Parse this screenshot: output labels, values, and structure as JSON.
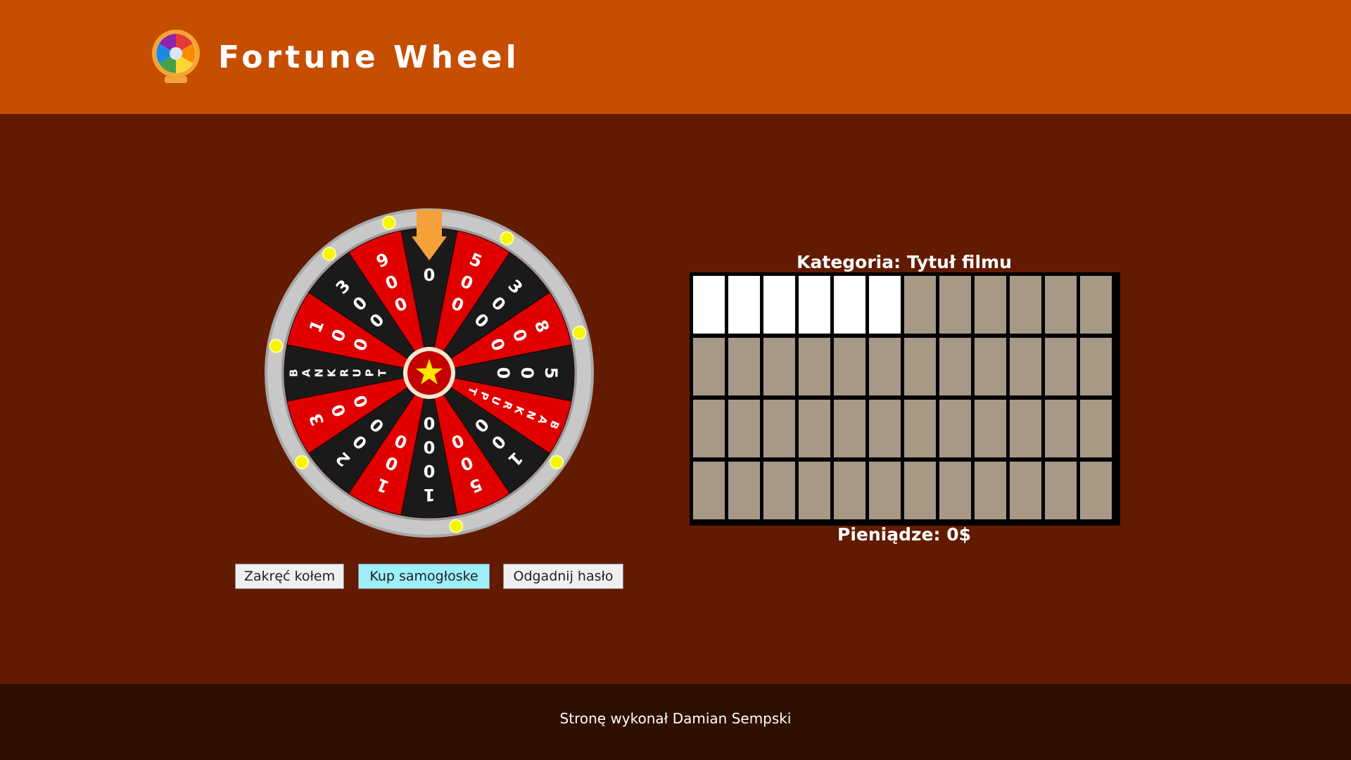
{
  "header": {
    "title": "Fortune Wheel",
    "logo_icon": "fortune-wheel-logo-icon"
  },
  "wheel": {
    "segments": [
      {
        "label": "00",
        "color": "#1a1a1a"
      },
      {
        "label": "500",
        "color": "#e00000"
      },
      {
        "label": "300",
        "color": "#1a1a1a"
      },
      {
        "label": "800",
        "color": "#e00000"
      },
      {
        "label": "500",
        "color": "#1a1a1a"
      },
      {
        "label": "BANKRUPT",
        "color": "#e00000"
      },
      {
        "label": "100",
        "color": "#1a1a1a"
      },
      {
        "label": "500",
        "color": "#e00000"
      },
      {
        "label": "1000",
        "color": "#1a1a1a"
      },
      {
        "label": "100",
        "color": "#e00000"
      },
      {
        "label": "200",
        "color": "#1a1a1a"
      },
      {
        "label": "300",
        "color": "#e00000"
      },
      {
        "label": "BANKRUPT",
        "color": "#1a1a1a"
      },
      {
        "label": "100",
        "color": "#e00000"
      },
      {
        "label": "300",
        "color": "#1a1a1a"
      },
      {
        "label": "900",
        "color": "#e00000"
      }
    ],
    "center_icon": "star-icon",
    "pointer_icon": "arrow-down-icon",
    "rim_color": "#c8c8c8",
    "light_color": "#f5f500"
  },
  "controls": {
    "spin_label": "Zakręć kołem",
    "buy_vowel_label": "Kup samogłoske",
    "guess_label": "Odgadnij hasło"
  },
  "board": {
    "category": "Kategoria: Tytuł filmu",
    "rows": 4,
    "cols": 12,
    "active_cells": [
      0,
      1,
      2,
      3,
      4,
      5
    ],
    "active_color": "#ffffff",
    "inactive_color": "#a89886",
    "money": "Pieniądze: 0$"
  },
  "footer": {
    "text": "Stronę wykonał Damian Sempski"
  }
}
